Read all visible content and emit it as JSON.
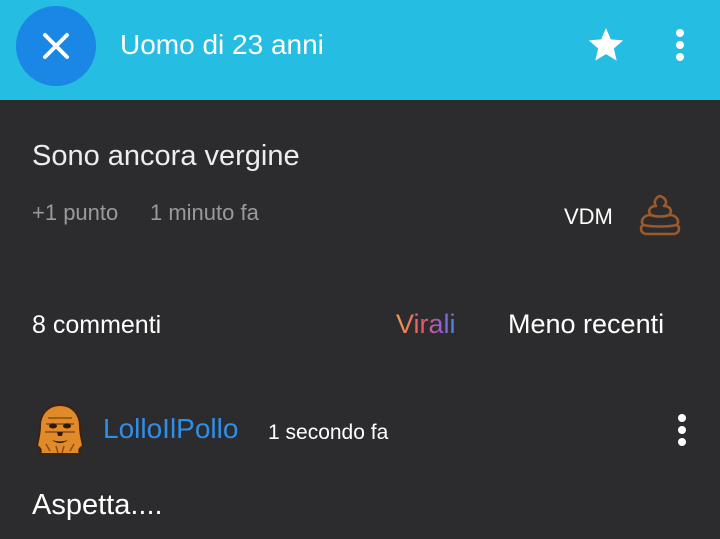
{
  "header": {
    "title": "Uomo di 23 anni",
    "close_icon": "close-icon",
    "star_icon": "star-icon",
    "menu_icon": "more-vertical-icon"
  },
  "post": {
    "text": "Sono ancora vergine",
    "points": "+1 punto",
    "time": "1 minuto fa",
    "vdm_label": "VDM",
    "poop_icon": "poop-icon"
  },
  "comments_bar": {
    "count_label": "8 commenti",
    "tab_virali": "Virali",
    "tab_recent": "Meno recenti"
  },
  "comment": {
    "avatar_icon": "wookiee-avatar-icon",
    "username": "LolloIlPollo",
    "time": "1 secondo fa",
    "text": "Aspetta....",
    "menu_icon": "more-vertical-icon"
  },
  "colors": {
    "header_bg": "#26bde2",
    "close_button_bg": "#1a86e6",
    "body_bg": "#2c2c2e",
    "username": "#2f8ee8",
    "poop": "#9a5a2c"
  }
}
